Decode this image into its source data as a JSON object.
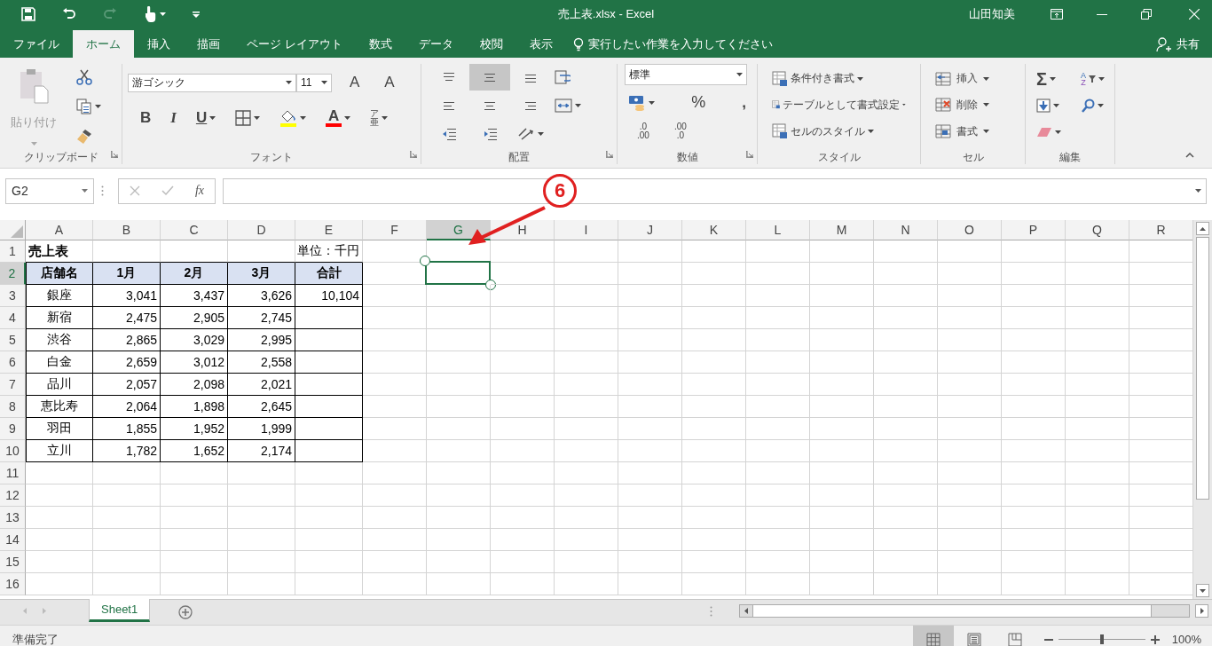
{
  "title_bar": {
    "title": "売上表.xlsx - Excel",
    "user": "山田知美"
  },
  "ribbon_tabs": [
    {
      "label": "ファイル",
      "selected": false
    },
    {
      "label": "ホーム",
      "selected": true
    },
    {
      "label": "挿入",
      "selected": false
    },
    {
      "label": "描画",
      "selected": false
    },
    {
      "label": "ページ レイアウト",
      "selected": false
    },
    {
      "label": "数式",
      "selected": false
    },
    {
      "label": "データ",
      "selected": false
    },
    {
      "label": "校閲",
      "selected": false
    },
    {
      "label": "表示",
      "selected": false
    }
  ],
  "tell_me": {
    "placeholder": "実行したい作業を入力してください"
  },
  "share": "共有",
  "ribbon": {
    "clipboard": {
      "label": "クリップボード",
      "paste": "貼り付け"
    },
    "font": {
      "label": "フォント",
      "font_name": "游ゴシック",
      "font_size": "11",
      "grow": "A",
      "shrink": "A",
      "bold": "B",
      "italic": "I",
      "underline": "U",
      "font_color_letter": "A",
      "phonetic_top": "ア",
      "phonetic_bottom": "亜"
    },
    "alignment": {
      "label": "配置",
      "vertical_align": [
        {
          "selected": false
        },
        {
          "selected": true
        },
        {
          "selected": false
        }
      ]
    },
    "number": {
      "label": "数値",
      "format": "標準",
      "percent": "%",
      "comma": ",",
      "increase_decimal": [
        ".0",
        ".00"
      ],
      "decrease_decimal": [
        ".00",
        ".0"
      ]
    },
    "styles": {
      "label": "スタイル",
      "items": [
        "条件付き書式",
        "テーブルとして書式設定",
        "セルのスタイル"
      ]
    },
    "cells": {
      "label": "セル",
      "items": [
        "挿入",
        "削除",
        "書式"
      ]
    },
    "editing": {
      "label": "編集",
      "autosum": "Σ",
      "sort_top": "A",
      "sort_bottom": "Z"
    }
  },
  "formula_bar": {
    "name_box": "G2",
    "fx": "fx"
  },
  "sheet": {
    "columns": [
      {
        "label": "A",
        "selected": false
      },
      {
        "label": "B",
        "selected": false
      },
      {
        "label": "C",
        "selected": false
      },
      {
        "label": "D",
        "selected": false
      },
      {
        "label": "E",
        "selected": false
      },
      {
        "label": "F",
        "selected": false
      },
      {
        "label": "G",
        "selected": true
      },
      {
        "label": "H",
        "selected": false
      },
      {
        "label": "I",
        "selected": false
      },
      {
        "label": "J",
        "selected": false
      },
      {
        "label": "K",
        "selected": false
      },
      {
        "label": "L",
        "selected": false
      },
      {
        "label": "M",
        "selected": false
      },
      {
        "label": "N",
        "selected": false
      },
      {
        "label": "O",
        "selected": false
      },
      {
        "label": "P",
        "selected": false
      },
      {
        "label": "Q",
        "selected": false
      },
      {
        "label": "R",
        "selected": false
      }
    ],
    "rows": [
      {
        "number": "1",
        "selected": false,
        "bordered": false,
        "cells": [
          {
            "kind": "title",
            "text": "売上表"
          },
          {
            "kind": "blank"
          },
          {
            "kind": "blank"
          },
          {
            "kind": "blank"
          },
          {
            "kind": "unit",
            "text": "単位：千円"
          }
        ]
      },
      {
        "number": "2",
        "selected": true,
        "bordered": true,
        "cells": [
          {
            "kind": "header",
            "text": "店舗名"
          },
          {
            "kind": "header",
            "text": "1月"
          },
          {
            "kind": "header",
            "text": "2月"
          },
          {
            "kind": "header",
            "text": "3月"
          },
          {
            "kind": "header",
            "text": "合計"
          }
        ]
      },
      {
        "number": "3",
        "selected": false,
        "bordered": true,
        "cells": [
          {
            "kind": "name",
            "text": "銀座"
          },
          {
            "kind": "number",
            "text": "3,041"
          },
          {
            "kind": "number",
            "text": "3,437"
          },
          {
            "kind": "number",
            "text": "3,626"
          },
          {
            "kind": "number",
            "text": "10,104"
          }
        ]
      },
      {
        "number": "4",
        "selected": false,
        "bordered": true,
        "cells": [
          {
            "kind": "name",
            "text": "新宿"
          },
          {
            "kind": "number",
            "text": "2,475"
          },
          {
            "kind": "number",
            "text": "2,905"
          },
          {
            "kind": "number",
            "text": "2,745"
          }
        ]
      },
      {
        "number": "5",
        "selected": false,
        "bordered": true,
        "cells": [
          {
            "kind": "name",
            "text": "渋谷"
          },
          {
            "kind": "number",
            "text": "2,865"
          },
          {
            "kind": "number",
            "text": "3,029"
          },
          {
            "kind": "number",
            "text": "2,995"
          }
        ]
      },
      {
        "number": "6",
        "selected": false,
        "bordered": true,
        "cells": [
          {
            "kind": "name",
            "text": "白金"
          },
          {
            "kind": "number",
            "text": "2,659"
          },
          {
            "kind": "number",
            "text": "3,012"
          },
          {
            "kind": "number",
            "text": "2,558"
          }
        ]
      },
      {
        "number": "7",
        "selected": false,
        "bordered": true,
        "cells": [
          {
            "kind": "name",
            "text": "品川"
          },
          {
            "kind": "number",
            "text": "2,057"
          },
          {
            "kind": "number",
            "text": "2,098"
          },
          {
            "kind": "number",
            "text": "2,021"
          }
        ]
      },
      {
        "number": "8",
        "selected": false,
        "bordered": true,
        "cells": [
          {
            "kind": "name",
            "text": "恵比寿"
          },
          {
            "kind": "number",
            "text": "2,064"
          },
          {
            "kind": "number",
            "text": "1,898"
          },
          {
            "kind": "number",
            "text": "2,645"
          }
        ]
      },
      {
        "number": "9",
        "selected": false,
        "bordered": true,
        "cells": [
          {
            "kind": "name",
            "text": "羽田"
          },
          {
            "kind": "number",
            "text": "1,855"
          },
          {
            "kind": "number",
            "text": "1,952"
          },
          {
            "kind": "number",
            "text": "1,999"
          }
        ]
      },
      {
        "number": "10",
        "selected": false,
        "bordered": true,
        "cells": [
          {
            "kind": "name",
            "text": "立川"
          },
          {
            "kind": "number",
            "text": "1,782"
          },
          {
            "kind": "number",
            "text": "1,652"
          },
          {
            "kind": "number",
            "text": "2,174"
          }
        ]
      },
      {
        "number": "11",
        "selected": false,
        "bordered": false
      },
      {
        "number": "12",
        "selected": false,
        "bordered": false
      },
      {
        "number": "13",
        "selected": false,
        "bordered": false
      },
      {
        "number": "14",
        "selected": false,
        "bordered": false
      },
      {
        "number": "15",
        "selected": false,
        "bordered": false
      },
      {
        "number": "16",
        "selected": false,
        "bordered": false
      }
    ]
  },
  "annotation": {
    "label": "6"
  },
  "sheet_tabs": [
    {
      "label": "Sheet1",
      "selected": true
    }
  ],
  "status_bar": {
    "status": "準備完了",
    "views": [
      {
        "kind": "normal",
        "selected": true
      },
      {
        "kind": "page_layout",
        "selected": false
      },
      {
        "kind": "page_break",
        "selected": false
      }
    ],
    "zoom": {
      "level": 0.5,
      "reading": "100%"
    }
  }
}
